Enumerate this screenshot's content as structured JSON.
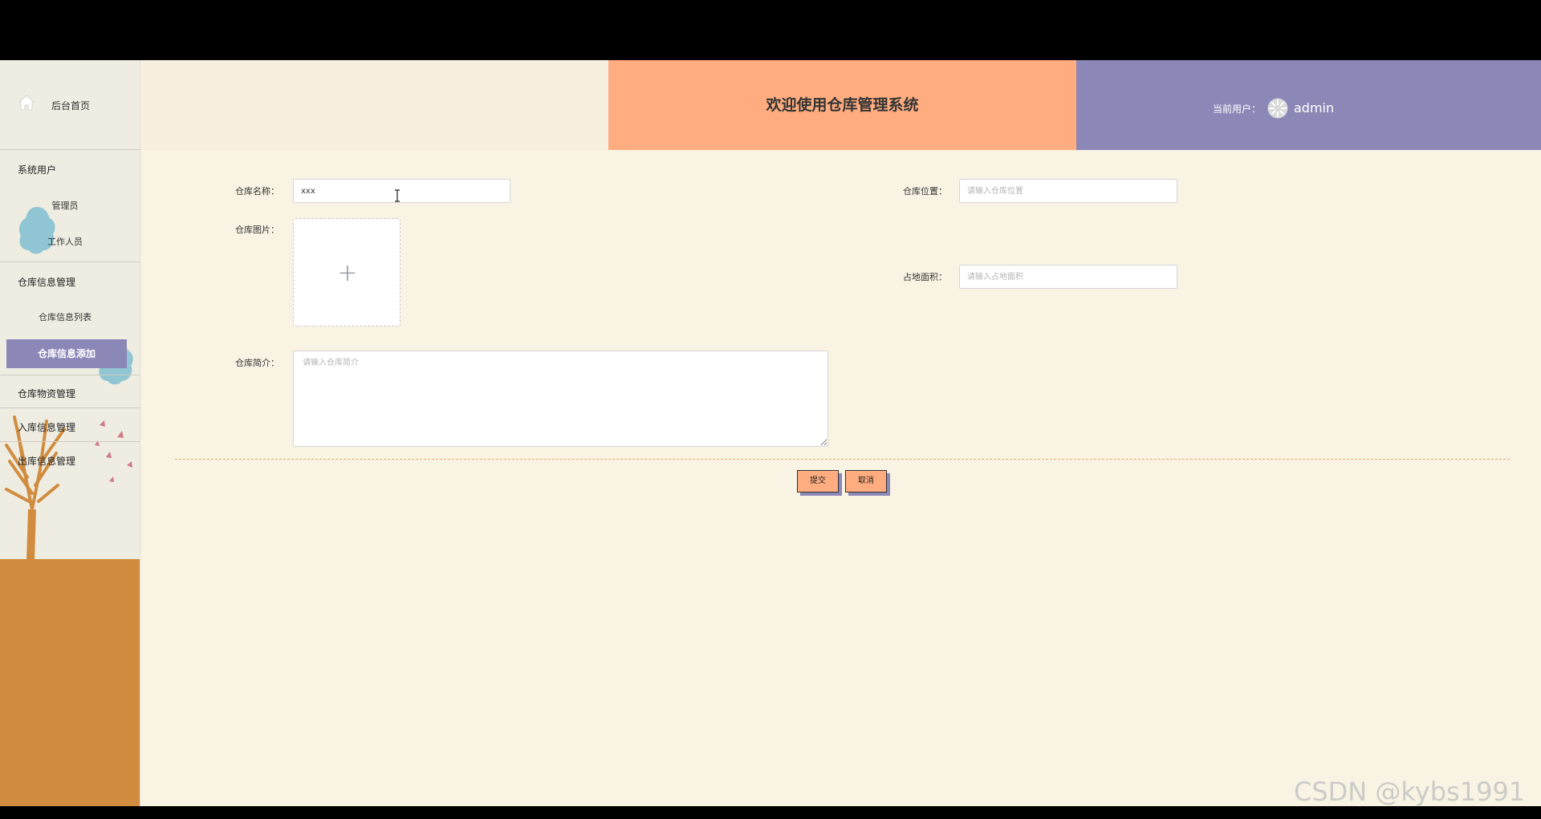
{
  "header": {
    "title": "欢迎使用仓库管理系统",
    "user_label": "当前用户：",
    "user_name": "admin"
  },
  "sidebar": {
    "home": "后台首页",
    "sections": [
      {
        "title": "系统用户",
        "items": [
          "管理员",
          "工作人员"
        ]
      },
      {
        "title": "仓库信息管理",
        "items": [
          "仓库信息列表",
          "仓库信息添加"
        ],
        "active": "仓库信息添加"
      },
      {
        "title": "仓库物资管理",
        "items": []
      },
      {
        "title": "入库信息管理",
        "items": []
      },
      {
        "title": "出库信息管理",
        "items": []
      }
    ]
  },
  "form": {
    "name": {
      "label": "仓库名称：",
      "value": "xxx"
    },
    "location": {
      "label": "仓库位置：",
      "placeholder": "请输入仓库位置"
    },
    "image": {
      "label": "仓库图片：",
      "plus": "+"
    },
    "area": {
      "label": "占地面积：",
      "placeholder": "请输入占地面积"
    },
    "intro": {
      "label": "仓库简介：",
      "placeholder": "请输入仓库简介"
    },
    "submit_label": "提交",
    "cancel_label": "取消"
  },
  "watermark": "CSDN @kybs1991",
  "colors": {
    "page_bg": "#f8f3e3",
    "sidebar_bg": "#efede2",
    "ground": "#d18c3f",
    "header_title_bg": "#ffad80",
    "header_user_bg": "#8b88b8",
    "active_nav_bg": "#8b88b8",
    "button_bg": "#ffad80",
    "cloud": "#90c5d3"
  }
}
